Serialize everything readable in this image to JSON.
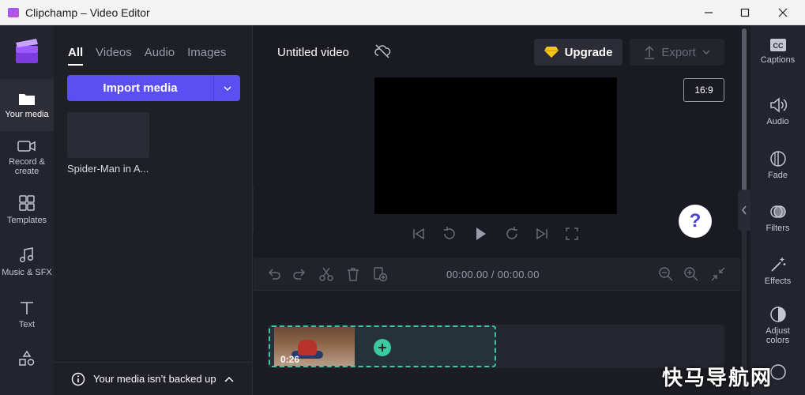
{
  "window": {
    "title": "Clipchamp – Video Editor"
  },
  "nav": {
    "items": [
      {
        "label": "Your media"
      },
      {
        "label": "Record &\ncreate"
      },
      {
        "label": "Templates"
      },
      {
        "label": "Music & SFX"
      },
      {
        "label": "Text"
      },
      {
        "label": ""
      }
    ]
  },
  "media": {
    "tabs": [
      {
        "label": "All"
      },
      {
        "label": "Videos"
      },
      {
        "label": "Audio"
      },
      {
        "label": "Images"
      }
    ],
    "import_label": "Import media",
    "items": [
      {
        "name": "Spider-Man in A..."
      }
    ],
    "backup_text": "Your media isn’t backed up"
  },
  "preview": {
    "video_title": "Untitled video",
    "upgrade_label": "Upgrade",
    "export_label": "Export",
    "aspect_ratio": "16:9",
    "help_glyph": "?"
  },
  "timeline": {
    "timecode": "00:00.00 / 00:00.00",
    "clip_duration": "0:26"
  },
  "rightbar": {
    "items": [
      {
        "label": "Captions",
        "icon": "cc-icon"
      },
      {
        "label": "Audio",
        "icon": "speaker-icon"
      },
      {
        "label": "Fade",
        "icon": "fade-icon"
      },
      {
        "label": "Filters",
        "icon": "filters-icon"
      },
      {
        "label": "Effects",
        "icon": "effects-icon"
      },
      {
        "label": "Adjust\ncolors",
        "icon": "adjust-colors-icon"
      }
    ]
  },
  "watermark": "快马导航网",
  "colors": {
    "accent": "#5b4ff2",
    "clip_border": "#3bc9a0",
    "upgrade_gem": "#f5c518"
  }
}
